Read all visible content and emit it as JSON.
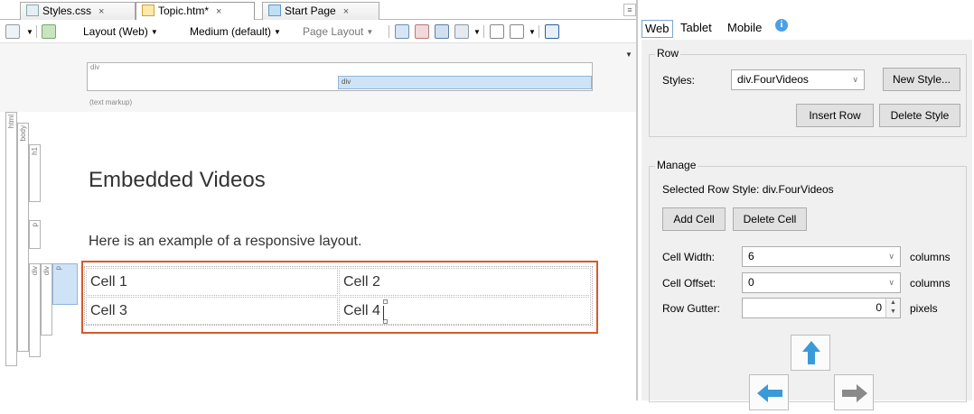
{
  "editor": {
    "tabs": [
      {
        "label": "Styles.css",
        "close": "×"
      },
      {
        "label": "Topic.htm*",
        "close": "×"
      },
      {
        "label": "Start Page",
        "close": "×"
      }
    ],
    "toolbar": {
      "layout": "Layout (Web)",
      "medium": "Medium (default)",
      "page_layout": "Page Layout"
    },
    "structure": {
      "outer_div": "div",
      "inner_div": "div",
      "text_markup": "(text markup)",
      "tags": [
        "html",
        "body",
        "h1",
        "p",
        "div",
        "div",
        "p"
      ]
    },
    "content": {
      "heading": "Embedded Videos",
      "paragraph": "Here is an example of a responsive layout.",
      "cells": [
        "Cell 1",
        "Cell 2",
        "Cell 3",
        "Cell 4"
      ]
    }
  },
  "panel": {
    "tabs": [
      "Web",
      "Tablet",
      "Mobile"
    ],
    "info_icon": "i",
    "row": {
      "title": "Row",
      "styles_label": "Styles:",
      "styles_value": "div.FourVideos",
      "new_style": "New Style...",
      "insert_row": "Insert Row",
      "delete_style": "Delete Style"
    },
    "manage": {
      "title": "Manage",
      "selected_row_style": "Selected Row Style: div.FourVideos",
      "add_cell": "Add Cell",
      "delete_cell": "Delete Cell",
      "cell_width_label": "Cell Width:",
      "cell_width_value": "6",
      "cell_width_unit": "columns",
      "cell_offset_label": "Cell Offset:",
      "cell_offset_value": "0",
      "cell_offset_unit": "columns",
      "row_gutter_label": "Row Gutter:",
      "row_gutter_value": "0",
      "row_gutter_unit": "pixels"
    }
  },
  "colors": {
    "selection_border": "#d55a2a",
    "arrow_blue": "#3a9ad9",
    "arrow_grey": "#8a8a8a"
  }
}
